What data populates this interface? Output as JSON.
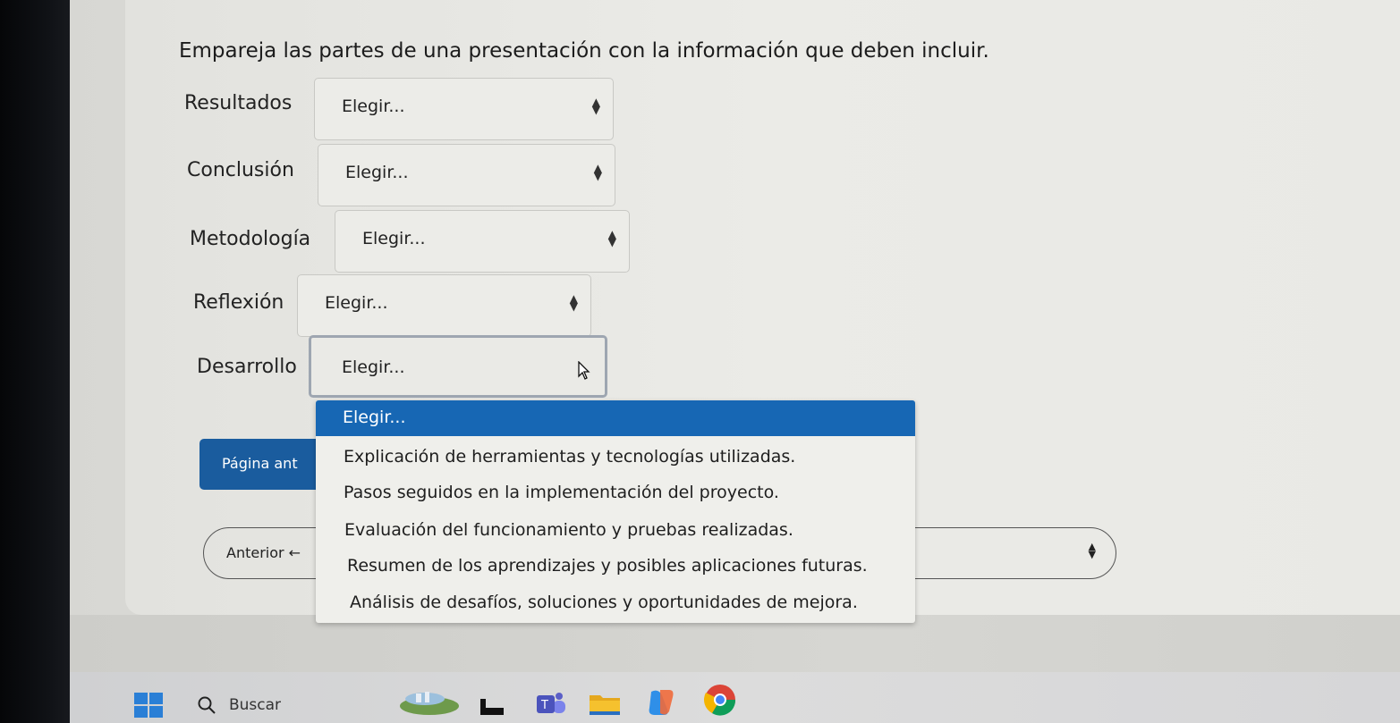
{
  "question": "Empareja las partes de una presentación con la información que deben incluir.",
  "rows": [
    {
      "label": "Resultados",
      "value": "Elegir..."
    },
    {
      "label": "Conclusión",
      "value": "Elegir..."
    },
    {
      "label": "Metodología",
      "value": "Elegir..."
    },
    {
      "label": "Reflexión",
      "value": "Elegir..."
    },
    {
      "label": "Desarrollo",
      "value": "Elegir..."
    }
  ],
  "dropdown": {
    "options": [
      "Elegir...",
      "Explicación de herramientas y tecnologías utilizadas.",
      "Pasos seguidos en la implementación del proyecto.",
      "Evaluación del funcionamiento y pruebas realizadas.",
      "Resumen de los aprendizajes y posibles aplicaciones futuras.",
      "Análisis de desafíos, soluciones y oportunidades de mejora."
    ],
    "selected_index": 0
  },
  "navigation": {
    "prev_button": "Página ant",
    "nav_select_label": "Anterior ←"
  },
  "taskbar": {
    "search_label": "Buscar"
  },
  "colors": {
    "accent": "#1767b4",
    "button": "#1a5c9e"
  }
}
